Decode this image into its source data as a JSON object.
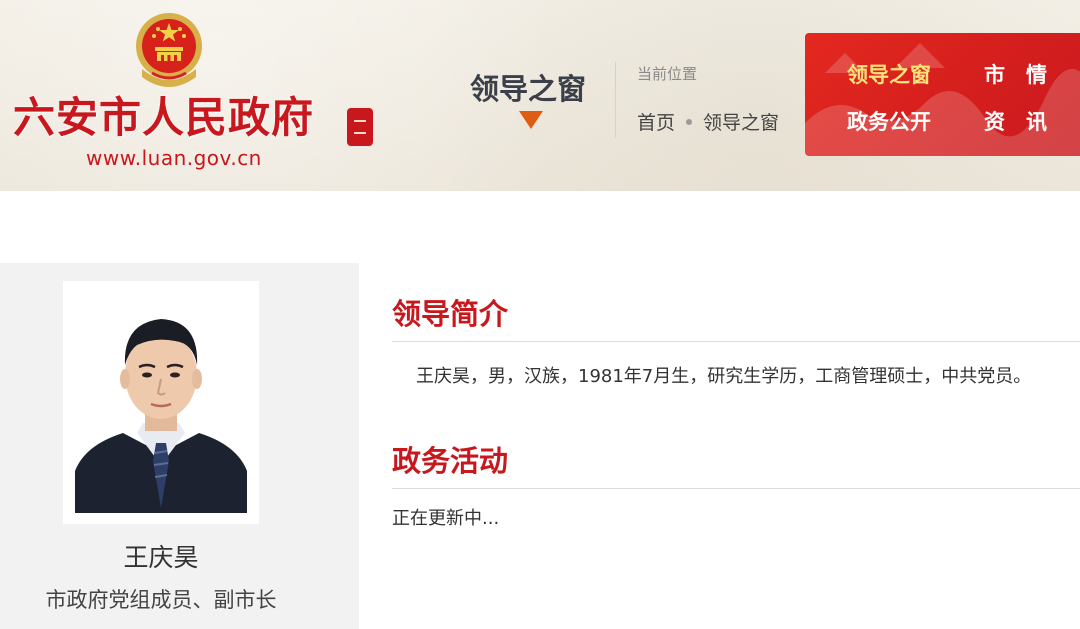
{
  "header": {
    "site_name": "六安市人民政府",
    "site_url": "www.luan.gov.cn",
    "section_title": "领导之窗",
    "location_label": "当前位置",
    "breadcrumb": [
      "首页",
      "领导之窗"
    ],
    "nav": [
      {
        "label": "领导之窗",
        "active": true
      },
      {
        "label": "市　情",
        "active": false
      },
      {
        "label": "政务公开",
        "active": false
      },
      {
        "label": "资　讯",
        "active": false
      }
    ]
  },
  "leader": {
    "name": "王庆昊",
    "title": "市政府党组成员、副市长"
  },
  "main": {
    "intro_heading": "领导简介",
    "intro_text": "王庆昊，男，汉族，1981年7月生，研究生学历，工商管理硕士，中共党员。",
    "activity_heading": "政务活动",
    "activity_text": "正在更新中..."
  },
  "colors": {
    "brand_red": "#c8171d",
    "nav_active": "#ffe27a",
    "arrow_orange": "#e05c13"
  },
  "icons": {
    "emblem": "national-emblem-icon",
    "seal": "seal-icon",
    "arrow": "triangle-down-icon"
  }
}
